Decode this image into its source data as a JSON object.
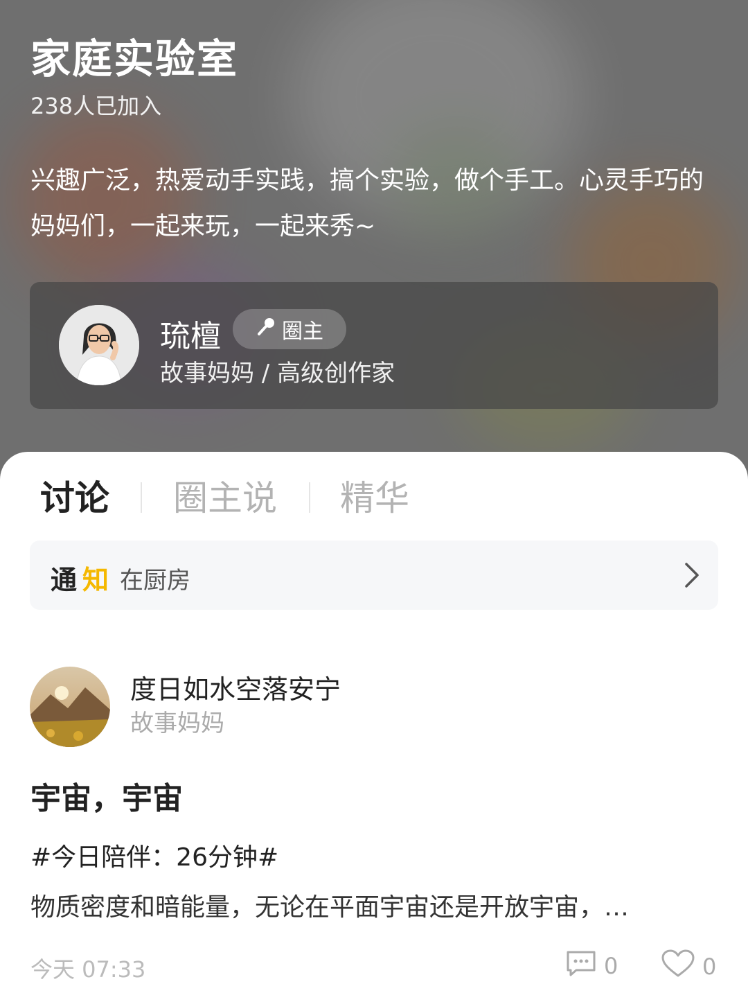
{
  "circle": {
    "title": "家庭实验室",
    "member_count": "238人已加入",
    "description": "兴趣广泛，热爱动手实践，搞个实验，做个手工。心灵手巧的妈妈们，一起来玩，一起来秀~"
  },
  "owner": {
    "name": "琉檀",
    "badge_icon": "microphone-icon",
    "badge_label": "圈主",
    "subtitle": "故事妈妈 / 高级创作家"
  },
  "tabs": [
    {
      "label": "讨论",
      "active": true
    },
    {
      "label": "圈主说",
      "active": false
    },
    {
      "label": "精华",
      "active": false
    }
  ],
  "notice": {
    "tag_part1": "通",
    "tag_part2": "知",
    "text": "在厨房",
    "accent_color": "#f5b800"
  },
  "post": {
    "author_name": "度日如水空落安宁",
    "author_role": "故事妈妈",
    "title": "宇宙，宇宙",
    "tag": "#今日陪伴：26分钟#",
    "excerpt": "物质密度和暗能量，无论在平面宇宙还是开放宇宙，…",
    "time": "今天 07:33",
    "comment_count": "0",
    "like_count": "0"
  }
}
